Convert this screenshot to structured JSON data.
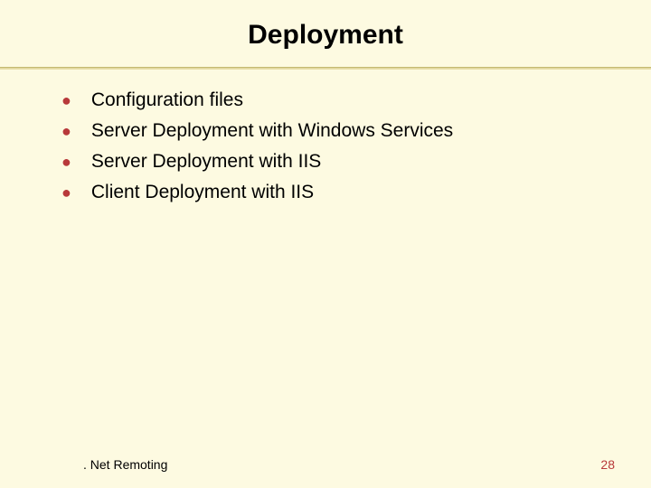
{
  "title": "Deployment",
  "bullets": [
    "Configuration files",
    "Server Deployment with Windows Services",
    "Server Deployment with IIS",
    "Client Deployment with IIS"
  ],
  "footer": {
    "left": ". Net Remoting",
    "right": "28"
  }
}
